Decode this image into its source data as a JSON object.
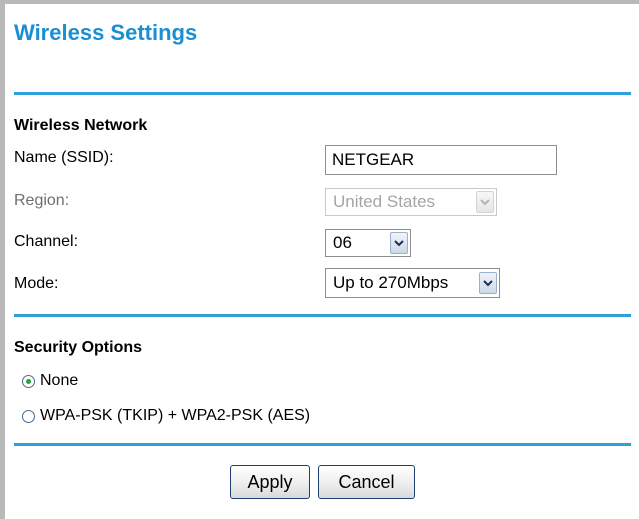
{
  "page": {
    "title": "Wireless Settings"
  },
  "wireless_network": {
    "heading": "Wireless Network",
    "ssid": {
      "label": "Name (SSID):",
      "value": "NETGEAR"
    },
    "region": {
      "label": "Region:",
      "value": "United States",
      "disabled": true
    },
    "channel": {
      "label": "Channel:",
      "value": "06"
    },
    "mode": {
      "label": "Mode:",
      "value": "Up to 270Mbps"
    }
  },
  "security_options": {
    "heading": "Security Options",
    "options": [
      {
        "label": "None",
        "checked": true
      },
      {
        "label": "WPA-PSK (TKIP) + WPA2-PSK (AES)",
        "checked": false
      }
    ]
  },
  "buttons": {
    "apply": "Apply",
    "cancel": "Cancel"
  },
  "colors": {
    "title": "#1a8fd3",
    "divider": "#2ea0dc",
    "radio_dot": "#2fa13a"
  }
}
